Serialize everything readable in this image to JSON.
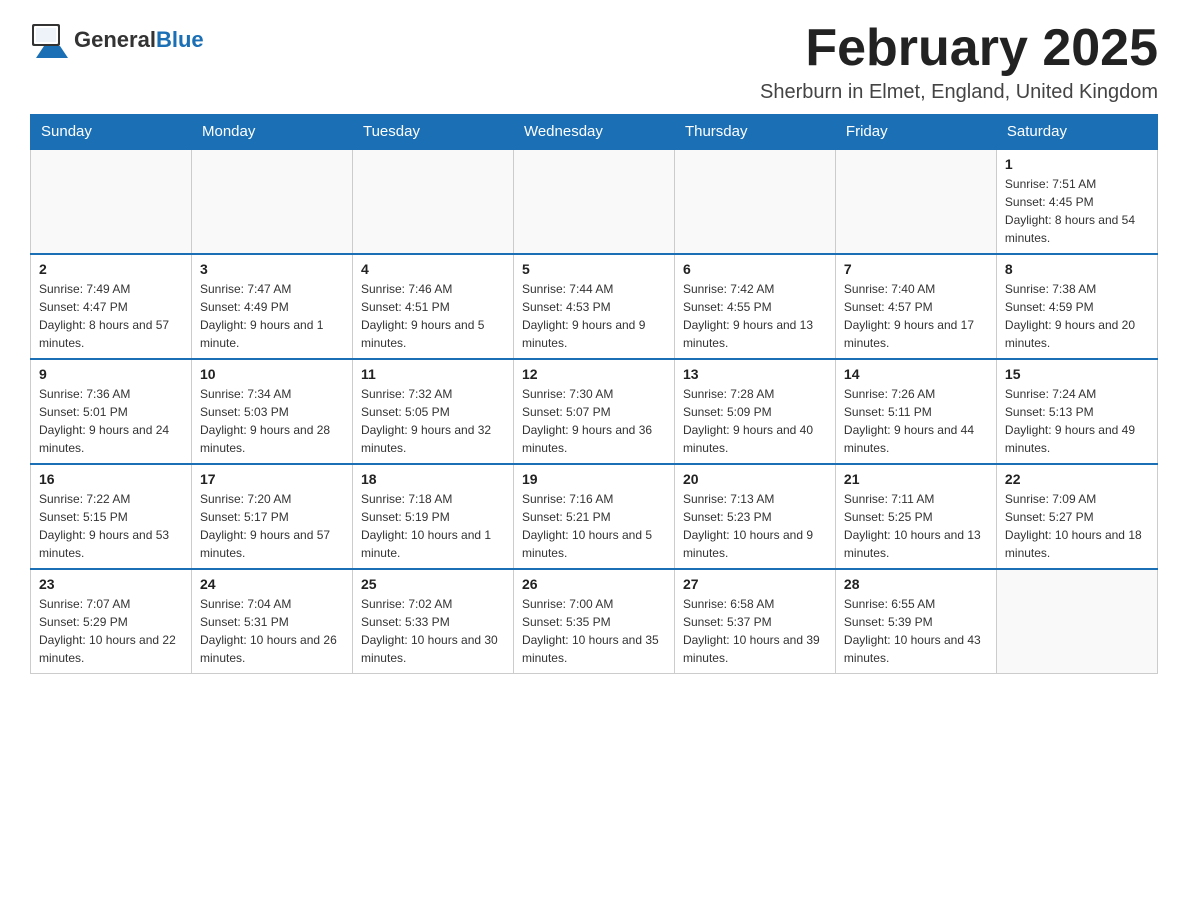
{
  "logo": {
    "general": "General",
    "blue": "Blue"
  },
  "title": "February 2025",
  "location": "Sherburn in Elmet, England, United Kingdom",
  "weekdays": [
    "Sunday",
    "Monday",
    "Tuesday",
    "Wednesday",
    "Thursday",
    "Friday",
    "Saturday"
  ],
  "weeks": [
    [
      {
        "day": "",
        "info": ""
      },
      {
        "day": "",
        "info": ""
      },
      {
        "day": "",
        "info": ""
      },
      {
        "day": "",
        "info": ""
      },
      {
        "day": "",
        "info": ""
      },
      {
        "day": "",
        "info": ""
      },
      {
        "day": "1",
        "info": "Sunrise: 7:51 AM\nSunset: 4:45 PM\nDaylight: 8 hours and 54 minutes."
      }
    ],
    [
      {
        "day": "2",
        "info": "Sunrise: 7:49 AM\nSunset: 4:47 PM\nDaylight: 8 hours and 57 minutes."
      },
      {
        "day": "3",
        "info": "Sunrise: 7:47 AM\nSunset: 4:49 PM\nDaylight: 9 hours and 1 minute."
      },
      {
        "day": "4",
        "info": "Sunrise: 7:46 AM\nSunset: 4:51 PM\nDaylight: 9 hours and 5 minutes."
      },
      {
        "day": "5",
        "info": "Sunrise: 7:44 AM\nSunset: 4:53 PM\nDaylight: 9 hours and 9 minutes."
      },
      {
        "day": "6",
        "info": "Sunrise: 7:42 AM\nSunset: 4:55 PM\nDaylight: 9 hours and 13 minutes."
      },
      {
        "day": "7",
        "info": "Sunrise: 7:40 AM\nSunset: 4:57 PM\nDaylight: 9 hours and 17 minutes."
      },
      {
        "day": "8",
        "info": "Sunrise: 7:38 AM\nSunset: 4:59 PM\nDaylight: 9 hours and 20 minutes."
      }
    ],
    [
      {
        "day": "9",
        "info": "Sunrise: 7:36 AM\nSunset: 5:01 PM\nDaylight: 9 hours and 24 minutes."
      },
      {
        "day": "10",
        "info": "Sunrise: 7:34 AM\nSunset: 5:03 PM\nDaylight: 9 hours and 28 minutes."
      },
      {
        "day": "11",
        "info": "Sunrise: 7:32 AM\nSunset: 5:05 PM\nDaylight: 9 hours and 32 minutes."
      },
      {
        "day": "12",
        "info": "Sunrise: 7:30 AM\nSunset: 5:07 PM\nDaylight: 9 hours and 36 minutes."
      },
      {
        "day": "13",
        "info": "Sunrise: 7:28 AM\nSunset: 5:09 PM\nDaylight: 9 hours and 40 minutes."
      },
      {
        "day": "14",
        "info": "Sunrise: 7:26 AM\nSunset: 5:11 PM\nDaylight: 9 hours and 44 minutes."
      },
      {
        "day": "15",
        "info": "Sunrise: 7:24 AM\nSunset: 5:13 PM\nDaylight: 9 hours and 49 minutes."
      }
    ],
    [
      {
        "day": "16",
        "info": "Sunrise: 7:22 AM\nSunset: 5:15 PM\nDaylight: 9 hours and 53 minutes."
      },
      {
        "day": "17",
        "info": "Sunrise: 7:20 AM\nSunset: 5:17 PM\nDaylight: 9 hours and 57 minutes."
      },
      {
        "day": "18",
        "info": "Sunrise: 7:18 AM\nSunset: 5:19 PM\nDaylight: 10 hours and 1 minute."
      },
      {
        "day": "19",
        "info": "Sunrise: 7:16 AM\nSunset: 5:21 PM\nDaylight: 10 hours and 5 minutes."
      },
      {
        "day": "20",
        "info": "Sunrise: 7:13 AM\nSunset: 5:23 PM\nDaylight: 10 hours and 9 minutes."
      },
      {
        "day": "21",
        "info": "Sunrise: 7:11 AM\nSunset: 5:25 PM\nDaylight: 10 hours and 13 minutes."
      },
      {
        "day": "22",
        "info": "Sunrise: 7:09 AM\nSunset: 5:27 PM\nDaylight: 10 hours and 18 minutes."
      }
    ],
    [
      {
        "day": "23",
        "info": "Sunrise: 7:07 AM\nSunset: 5:29 PM\nDaylight: 10 hours and 22 minutes."
      },
      {
        "day": "24",
        "info": "Sunrise: 7:04 AM\nSunset: 5:31 PM\nDaylight: 10 hours and 26 minutes."
      },
      {
        "day": "25",
        "info": "Sunrise: 7:02 AM\nSunset: 5:33 PM\nDaylight: 10 hours and 30 minutes."
      },
      {
        "day": "26",
        "info": "Sunrise: 7:00 AM\nSunset: 5:35 PM\nDaylight: 10 hours and 35 minutes."
      },
      {
        "day": "27",
        "info": "Sunrise: 6:58 AM\nSunset: 5:37 PM\nDaylight: 10 hours and 39 minutes."
      },
      {
        "day": "28",
        "info": "Sunrise: 6:55 AM\nSunset: 5:39 PM\nDaylight: 10 hours and 43 minutes."
      },
      {
        "day": "",
        "info": ""
      }
    ]
  ]
}
